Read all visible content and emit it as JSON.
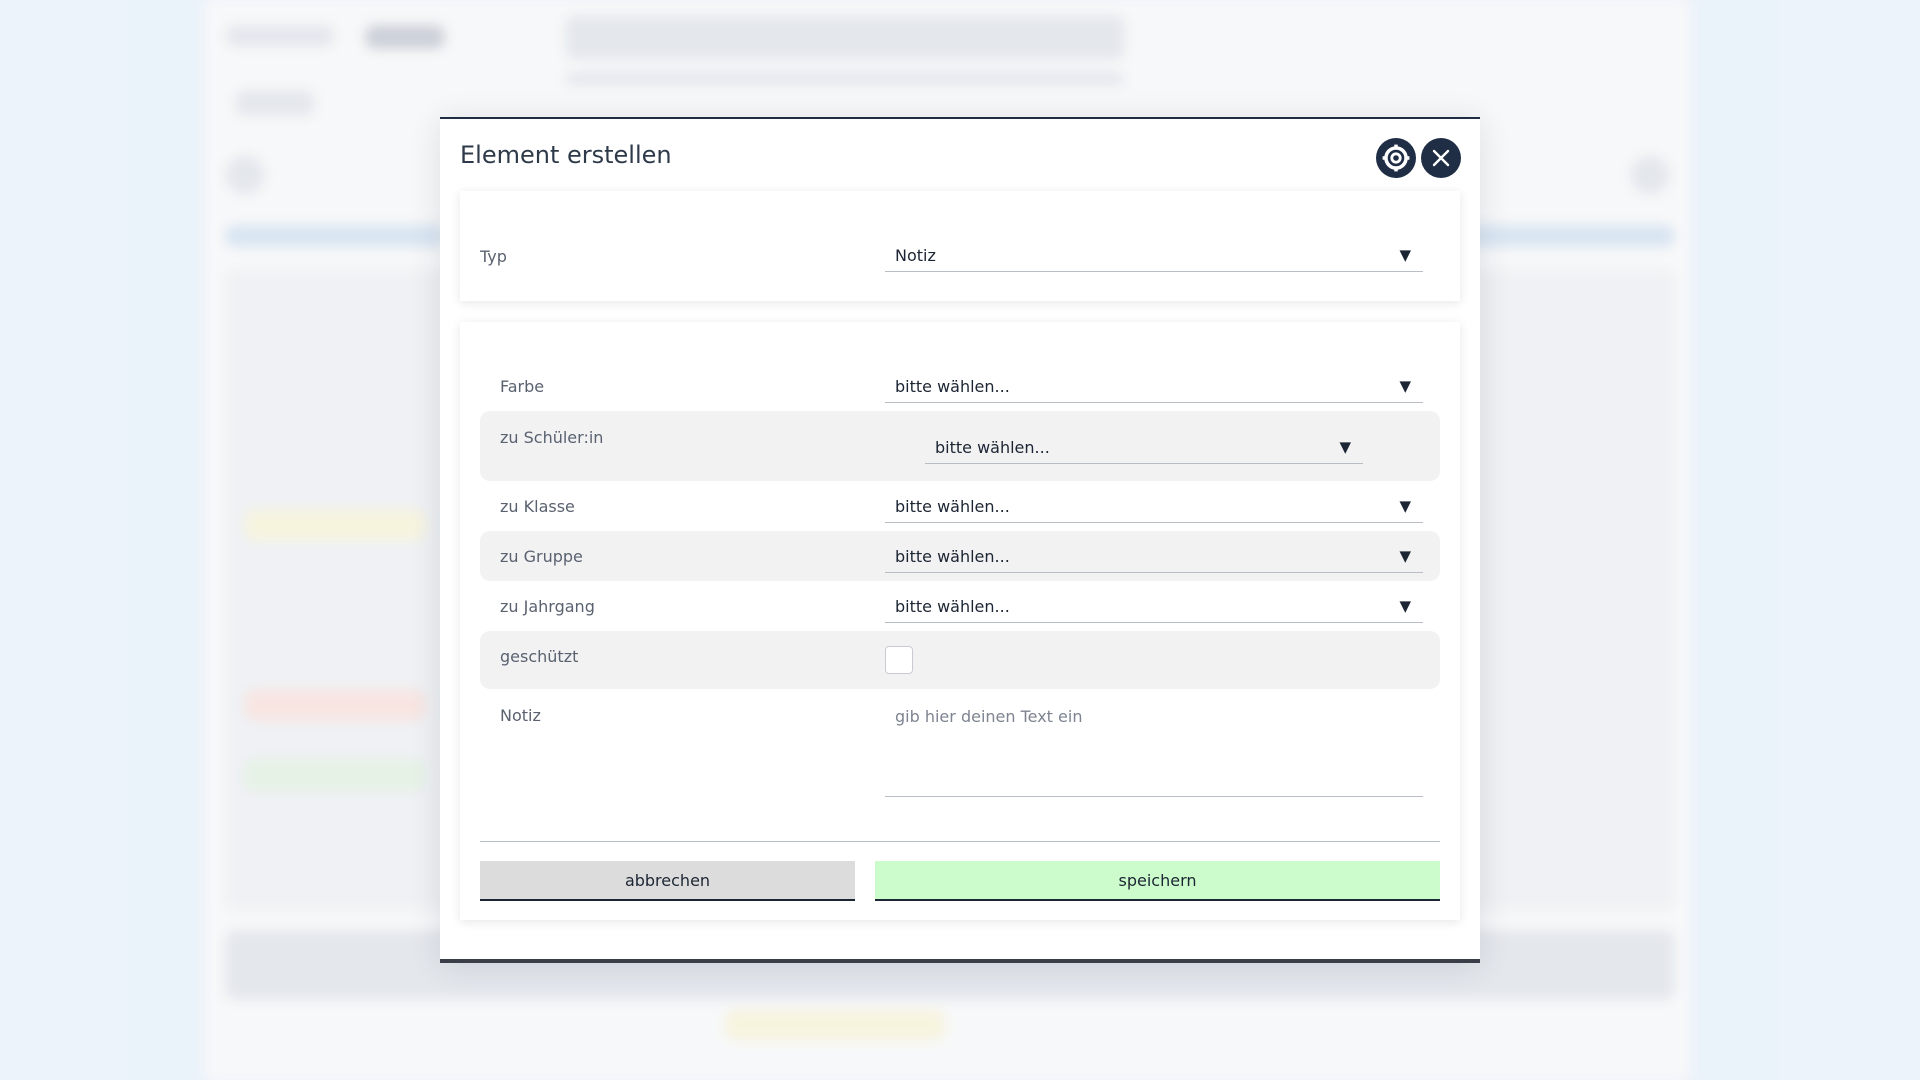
{
  "modal": {
    "title": "Element erstellen",
    "icons": {
      "settings": "gear-icon",
      "close": "close-icon"
    },
    "colors": {
      "accent": "#1f2d45",
      "save": "#ccfccc",
      "cancel": "#dcdcdc"
    }
  },
  "type_field": {
    "label": "Typ",
    "value": "Notiz"
  },
  "fields": {
    "farbe": {
      "label": "Farbe",
      "value": "bitte wählen..."
    },
    "schueler": {
      "label": "zu Schüler:in",
      "value": "bitte wählen..."
    },
    "klasse": {
      "label": "zu Klasse",
      "value": "bitte wählen..."
    },
    "gruppe": {
      "label": "zu Gruppe",
      "value": "bitte wählen..."
    },
    "jahrgang": {
      "label": "zu Jahrgang",
      "value": "bitte wählen..."
    },
    "geschuetzt": {
      "label": "geschützt",
      "checked": false
    },
    "notiz": {
      "label": "Notiz",
      "placeholder": "gib hier deinen Text ein"
    }
  },
  "dropdown_arrow": "▼",
  "buttons": {
    "cancel": "abbrechen",
    "save": "speichern"
  }
}
